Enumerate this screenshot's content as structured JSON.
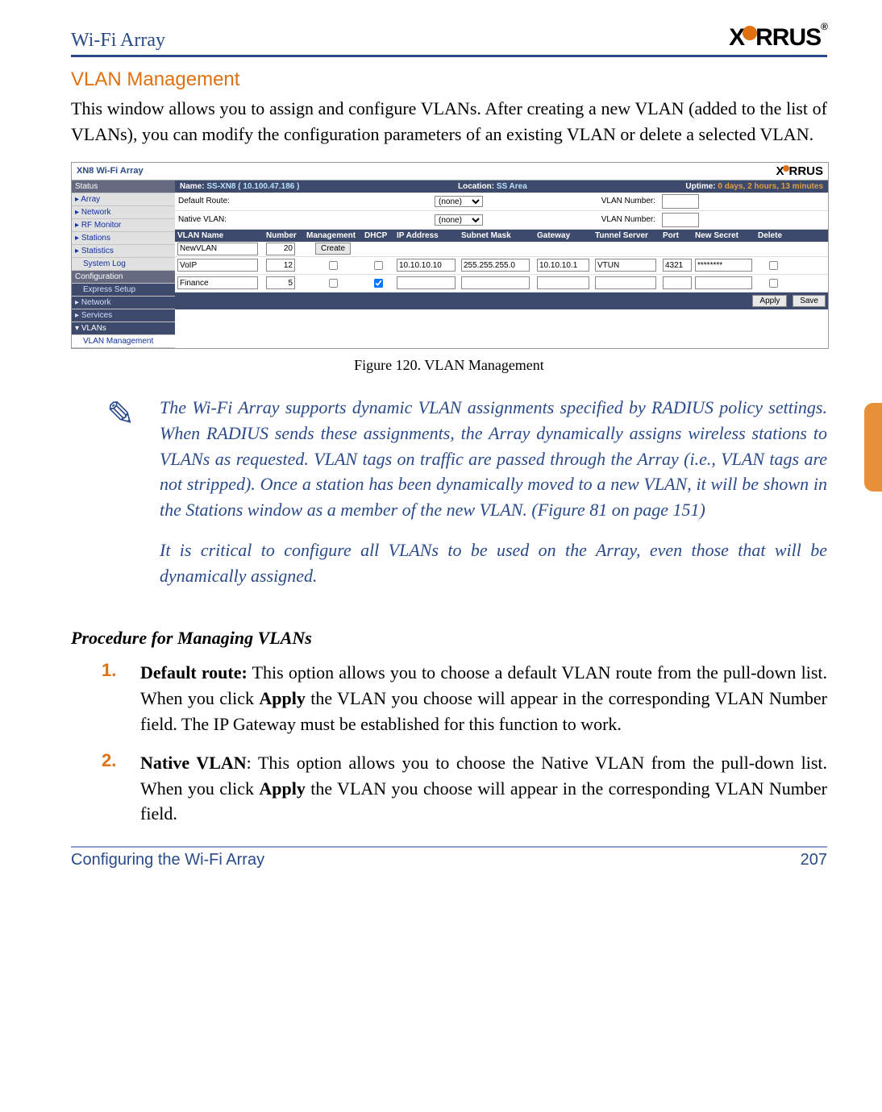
{
  "header": {
    "product": "Wi-Fi Array",
    "brand_main": "X",
    "brand_rest": "RRUS"
  },
  "section_title": "VLAN Management",
  "intro": "This window allows you to assign and configure VLANs. After creating a new VLAN (added to the list of VLANs), you can modify the configuration parameters of an existing VLAN or delete a selected VLAN.",
  "figure_caption": "Figure 120. VLAN Management",
  "note": {
    "p1": "The Wi-Fi Array supports dynamic VLAN assignments specified by RADIUS policy settings. When RADIUS sends these assignments, the Array dynamically assigns wireless stations to VLANs as requested. VLAN tags on traffic are passed through the Array (i.e., VLAN tags are not stripped). Once a station has been dynamically moved to a new VLAN, it will be shown in the Stations window as a member of the new VLAN. (Figure 81 on page 151)",
    "p2": "It is critical to configure all VLANs to be used on the Array, even those that will be dynamically assigned."
  },
  "proc_heading": "Procedure for Managing VLANs",
  "steps": [
    {
      "n": "1.",
      "b": "Default route:",
      "t": " This option allows you to choose a default VLAN route from the pull-down list. When you click ",
      "b2": "Apply",
      "t2": " the VLAN you choose will appear in the corresponding VLAN Number field. The IP Gateway must be established for this function to work."
    },
    {
      "n": "2.",
      "b": "Native VLAN",
      "t": ": This option allows you to choose the Native VLAN from the pull-down list. When you click ",
      "b2": "Apply",
      "t2": " the VLAN you choose will appear in the corresponding VLAN Number field."
    }
  ],
  "footer": {
    "left": "Configuring the Wi-Fi Array",
    "right": "207"
  },
  "shot": {
    "title": "XN8 Wi-Fi Array",
    "name_label": "Name:",
    "name_value": "SS-XN8  ( 10.100.47.186 )",
    "loc_label": "Location:",
    "loc_value": "SS Area",
    "up_label": "Uptime:",
    "up_value": "0 days, 2 hours, 13 minutes",
    "default_route": "Default Route:",
    "native_vlan": "Native VLAN:",
    "dd_none": "(none)",
    "vlan_num_label": "VLAN Number:",
    "create_btn": "Create",
    "apply_btn": "Apply",
    "save_btn": "Save",
    "cols": [
      "VLAN Name",
      "Number",
      "Management",
      "DHCP",
      "IP Address",
      "Subnet Mask",
      "Gateway",
      "Tunnel Server",
      "Port",
      "New Secret",
      "Delete"
    ],
    "nav": {
      "status": "Status",
      "array": "Array",
      "network": "Network",
      "rf": "RF Monitor",
      "stations": "Stations",
      "stats": "Statistics",
      "syslog": "System Log",
      "config": "Configuration",
      "express": "Express Setup",
      "net2": "Network",
      "services": "Services",
      "vlans": "VLANs",
      "vlanmgmt": "VLAN Management"
    },
    "rows": [
      {
        "name": "NewVLAN",
        "num": "20",
        "mgmt": false,
        "dhcp": false,
        "ip": "",
        "mask": "",
        "gw": "",
        "ts": "",
        "port": "",
        "secret": "",
        "del": false,
        "create": true
      },
      {
        "name": "VoIP",
        "num": "12",
        "mgmt": false,
        "dhcp": false,
        "ip": "10.10.10.10",
        "mask": "255.255.255.0",
        "gw": "10.10.10.1",
        "ts": "VTUN",
        "port": "4321",
        "secret": "********",
        "del": false
      },
      {
        "name": "Finance",
        "num": "5",
        "mgmt": false,
        "dhcp": true,
        "ip": "",
        "mask": "",
        "gw": "",
        "ts": "",
        "port": "",
        "secret": "",
        "del": false
      }
    ]
  }
}
